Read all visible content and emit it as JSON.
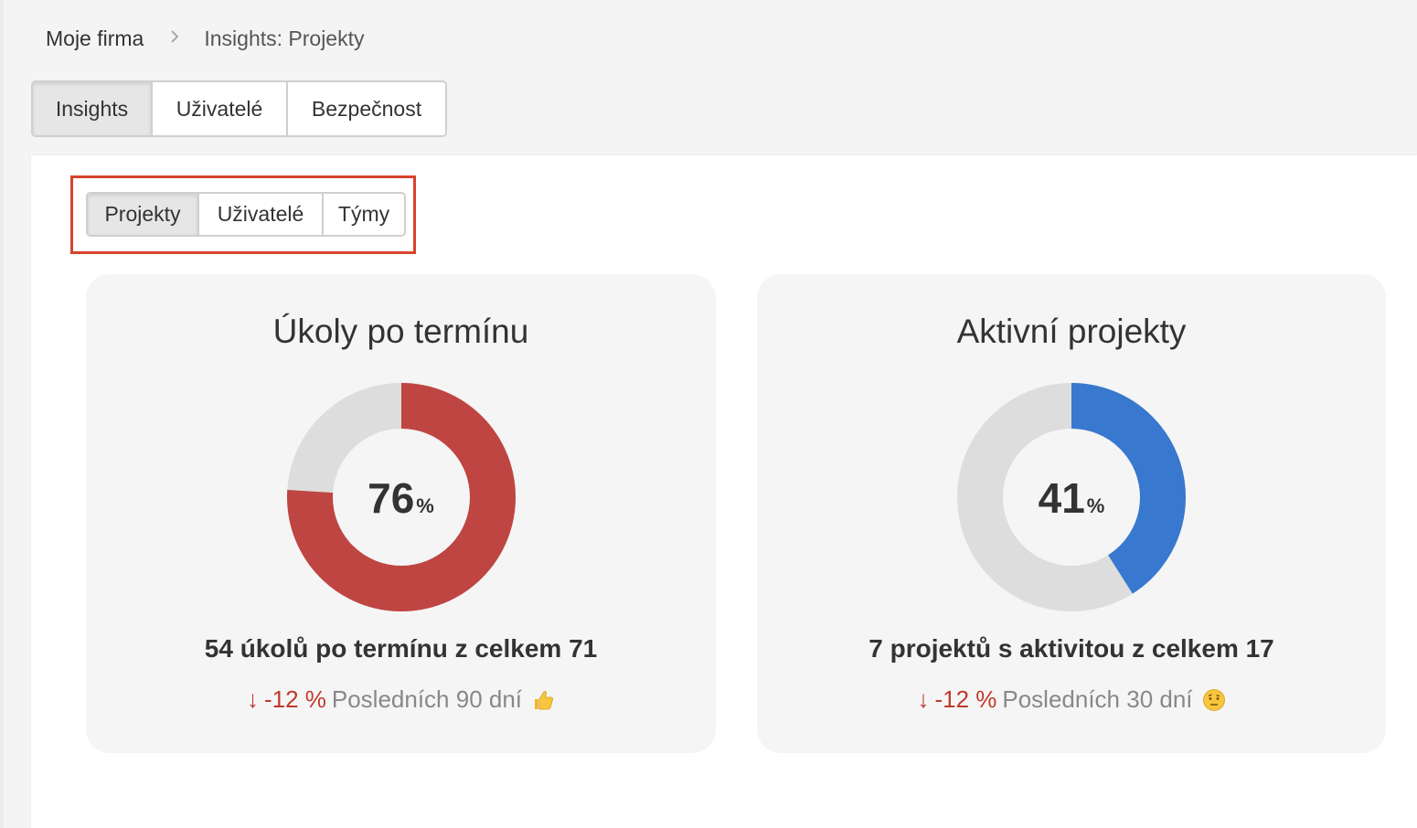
{
  "breadcrumb": {
    "home": "Moje firma",
    "separator": ">",
    "current": "Insights: Projekty"
  },
  "main_tabs": [
    {
      "label": "Insights",
      "active": true
    },
    {
      "label": "Uživatelé",
      "active": false
    },
    {
      "label": "Bezpečnost",
      "active": false
    }
  ],
  "sub_tabs": [
    {
      "label": "Projekty",
      "active": true
    },
    {
      "label": "Uživatelé",
      "active": false
    },
    {
      "label": "Týmy",
      "active": false
    }
  ],
  "cards": [
    {
      "title": "Úkoly po termínu",
      "percent": "76",
      "percent_unit": "%",
      "summary_count": "54",
      "summary_text": "úkolů po termínu z celkem 71",
      "trend_arrow": "↓",
      "trend_change": "-12 %",
      "trend_period": "Posledních 90 dní",
      "emoji": "thumbs-up-icon",
      "color": "#bf4542"
    },
    {
      "title": "Aktivní projekty",
      "percent": "41",
      "percent_unit": "%",
      "summary_count": "7",
      "summary_text": "projektů s aktivitou z celkem 17",
      "trend_arrow": "↓",
      "trend_change": "-12 %",
      "trend_period": "Posledních 30 dní",
      "emoji": "raised-eyebrow-face-icon",
      "color": "#3878cf"
    }
  ],
  "colors": {
    "track": "#dddddd",
    "accent_red": "#d8432e",
    "trend_red": "#c0392b"
  }
}
